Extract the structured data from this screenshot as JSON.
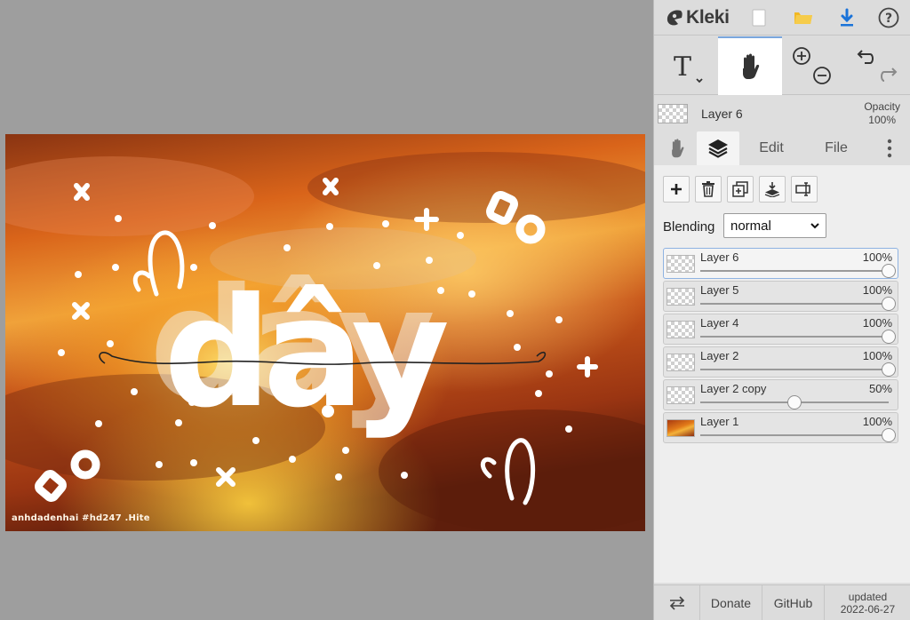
{
  "app": {
    "name": "Kleki"
  },
  "canvas": {
    "watermark": "anhdadenhai #hd247 .Hite"
  },
  "toolbar": {
    "icons": [
      "new-image-icon",
      "open-folder-icon",
      "download-icon",
      "help-icon"
    ],
    "tools": [
      "text-tool-icon",
      "hand-tool-icon",
      "zoom-in-icon",
      "zoom-out-icon",
      "undo-icon",
      "redo-icon"
    ]
  },
  "layer_info": {
    "name": "Layer 6",
    "opacity_label": "Opacity",
    "opacity_value": "100%"
  },
  "tabs": {
    "edit": "Edit",
    "file": "File"
  },
  "layers_panel": {
    "blending_label": "Blending",
    "blending_value": "normal",
    "layers": [
      {
        "name": "Layer 6",
        "opacity": "100%",
        "level": 1.0,
        "active": true
      },
      {
        "name": "Layer 5",
        "opacity": "100%",
        "level": 1.0
      },
      {
        "name": "Layer 4",
        "opacity": "100%",
        "level": 1.0
      },
      {
        "name": "Layer 2",
        "opacity": "100%",
        "level": 1.0
      },
      {
        "name": "Layer 2 copy",
        "opacity": "50%",
        "level": 0.5
      },
      {
        "name": "Layer 1",
        "opacity": "100%",
        "level": 1.0
      }
    ]
  },
  "footer": {
    "donate": "Donate",
    "github": "GitHub",
    "updated_label": "updated",
    "updated_date": "2022-06-27"
  },
  "colors": {
    "accent": "#1a73d9",
    "folder": "#f2b823",
    "active_border": "#8fb3e2"
  }
}
